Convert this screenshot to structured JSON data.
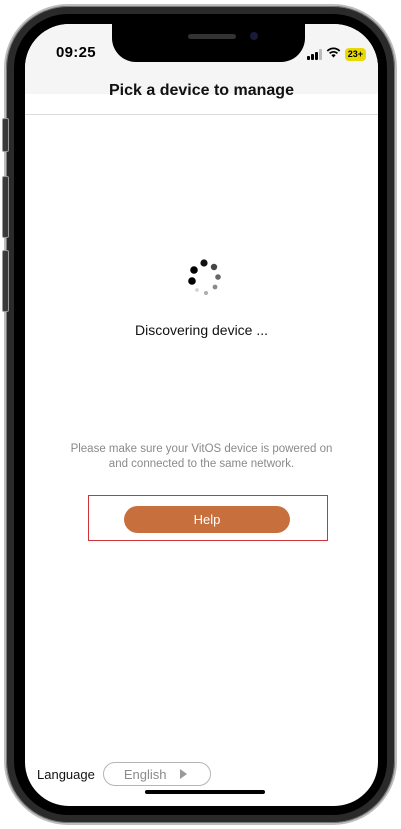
{
  "status_bar": {
    "time": "09:25",
    "battery": "23+",
    "icons": [
      "signal-icon",
      "wifi-icon",
      "battery-icon"
    ]
  },
  "header": {
    "title": "Pick a device to manage"
  },
  "main": {
    "spinner_icon": "loading-spinner-icon",
    "status_text": "Discovering device ...",
    "hint_line1": "Please make sure your VitOS device is powered on",
    "hint_line2": "and connected to the same network.",
    "help_label": "Help"
  },
  "footer": {
    "language_label": "Language",
    "language_value": "English",
    "language_arrow_icon": "chevron-right-icon"
  },
  "colors": {
    "help_button": "#c7703e",
    "highlight_border": "#d0343a",
    "battery": "#e8d900"
  }
}
